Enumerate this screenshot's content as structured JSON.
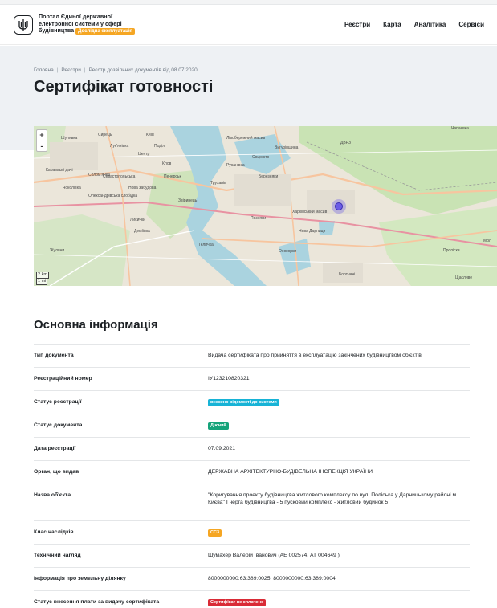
{
  "header": {
    "brand_line1": "Портал Єдиної державної",
    "brand_line2": "електронної системи у сфері",
    "brand_line3": "будівництва",
    "brand_badge": "Дослідна експлуатація",
    "nav": [
      "Реєстри",
      "Карта",
      "Аналітика",
      "Сервіси"
    ]
  },
  "breadcrumbs": [
    "Головна",
    "Реєстри",
    "Реєстр дозвільних документів від 08.07.2020"
  ],
  "page_title": "Сертифікат готовності",
  "map": {
    "zoom_in": "+",
    "zoom_out": "-",
    "scale_km": "2 km",
    "scale_mi": "1 mi",
    "labels": [
      "Шулявка",
      "Київ",
      "Лук'янівка",
      "Поділ",
      "Караваєві дачі",
      "Солом'янка",
      "Чоколівка",
      "Олександрівська слобідка",
      "Севастопольська",
      "Нова забудова",
      "Печерськ",
      "Звіринець",
      "Сирець",
      "Центр",
      "Клов",
      "Лисички",
      "Деміївка",
      "Жуляни",
      "Теличка",
      "Осокорки",
      "Позняки",
      "Харківський масив",
      "Березняки",
      "Русанівка",
      "Лівобережний масив",
      "Соцмісто",
      "ДВРЗ",
      "Труханів",
      "Нова Дарниця",
      "Бортничі",
      "Чапаєвка",
      "Проліски",
      "Мол",
      "Щасливе",
      "Вигурівщина"
    ],
    "marker_color": "#6b5ce7"
  },
  "section_title": "Основна інформація",
  "info": [
    {
      "key": "Тип документа",
      "value": "Видача сертифіката про прийняття в експлуатацію закінчених будівництвом об'єктів"
    },
    {
      "key": "Реєстраційний номер",
      "value": "ІУ123210820321"
    },
    {
      "key": "Статус реєстрації",
      "badge": "внесено відомості до системи",
      "badge_color": "cyan"
    },
    {
      "key": "Статус документа",
      "badge": "Діючий",
      "badge_color": "green"
    },
    {
      "key": "Дата реєстрації",
      "value": "07.09.2021"
    },
    {
      "key": "Орган, що видав",
      "value": "ДЕРЖАВНА АРХІТЕКТУРНО-БУДІВЕЛЬНА ІНСПЕКЦІЯ УКРАЇНИ"
    },
    {
      "key": "Назва об'єкта",
      "value": "\"Коригування проекту будівництва житлового комплексу по вул. Поліська у Дарницькому районі м. Києва\" І черга будівництва - 5 пусковий комплекс - житловий будинок 5"
    },
    {
      "key": "Клас наслідків",
      "badge": "СС3",
      "badge_color": "orange"
    },
    {
      "key": "Технічний нагляд",
      "value": "Шумахер Валерій Іванович (АЕ 002574, АТ 004649 )"
    },
    {
      "key": "Інформація про земельну ділянку",
      "value": "8000000000:63:389:0025, 8000000000:63:389:0004"
    },
    {
      "key": "Статус внесення плати за видачу сертифіката",
      "badge": "Сертифікат не сплачено",
      "badge_color": "red"
    }
  ]
}
